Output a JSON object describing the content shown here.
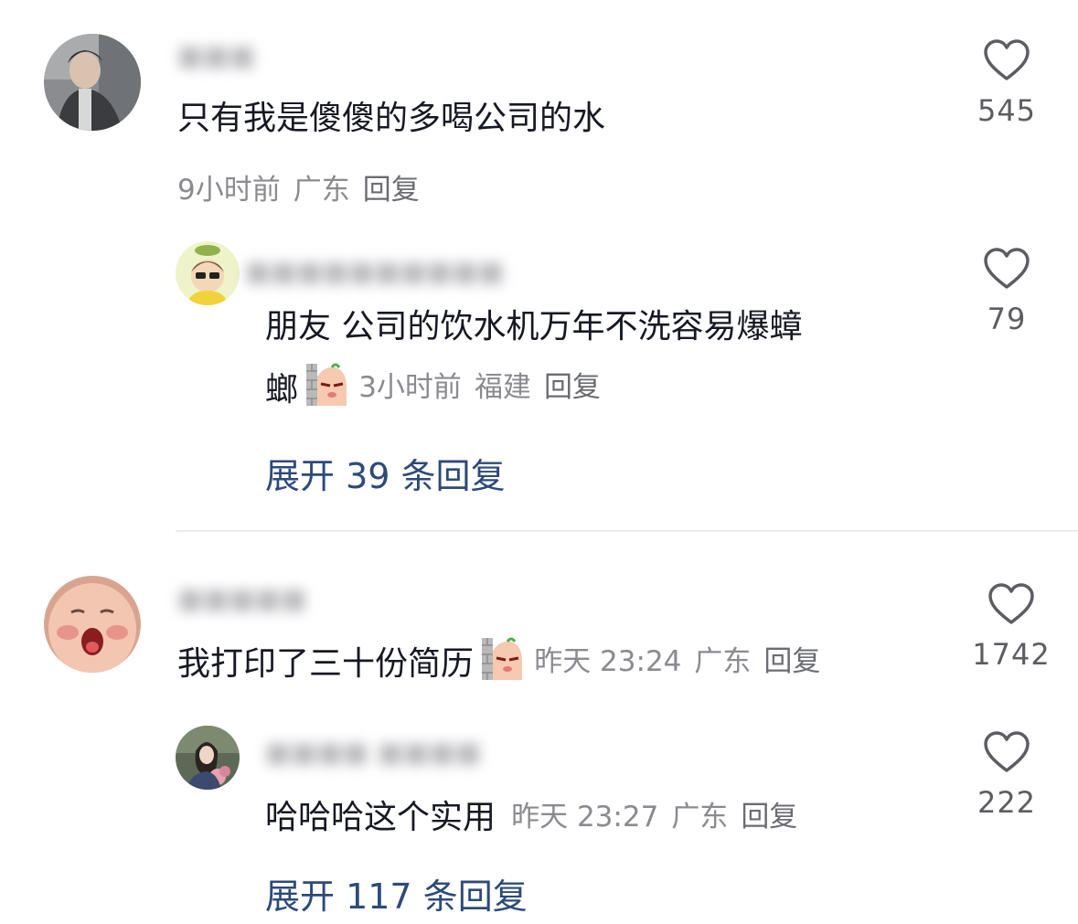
{
  "comments": [
    {
      "username": "■■■",
      "text": "只有我是傻傻的多喝公司的水",
      "time": "9小时前",
      "location": "广东",
      "reply_label": "回复",
      "likes": "545",
      "replies": [
        {
          "username": "■■■■■■■■■■",
          "text_line1": "朋友 公司的饮水机万年不洗容易爆蟑",
          "text_line2": "螂",
          "time": "3小时前",
          "location": "福建",
          "reply_label": "回复",
          "likes": "79"
        }
      ],
      "expand_label": "展开 39 条回复"
    },
    {
      "username": "■■■■■",
      "text": "我打印了三十份简历",
      "time": "昨天 23:24",
      "location": "广东",
      "reply_label": "回复",
      "likes": "1742",
      "replies": [
        {
          "username": "■■■■ ■■■■",
          "text": "哈哈哈这个实用",
          "time": "昨天 23:27",
          "location": "广东",
          "reply_label": "回复",
          "likes": "222"
        }
      ],
      "expand_label": "展开 117 条回复"
    }
  ],
  "icons": {
    "like": "heart-outline-icon",
    "emoji": "wall-peek-emoji"
  },
  "colors": {
    "text": "#161823",
    "meta": "#8a8b91",
    "expand": "#2d4a7a",
    "divider": "#ececee"
  }
}
